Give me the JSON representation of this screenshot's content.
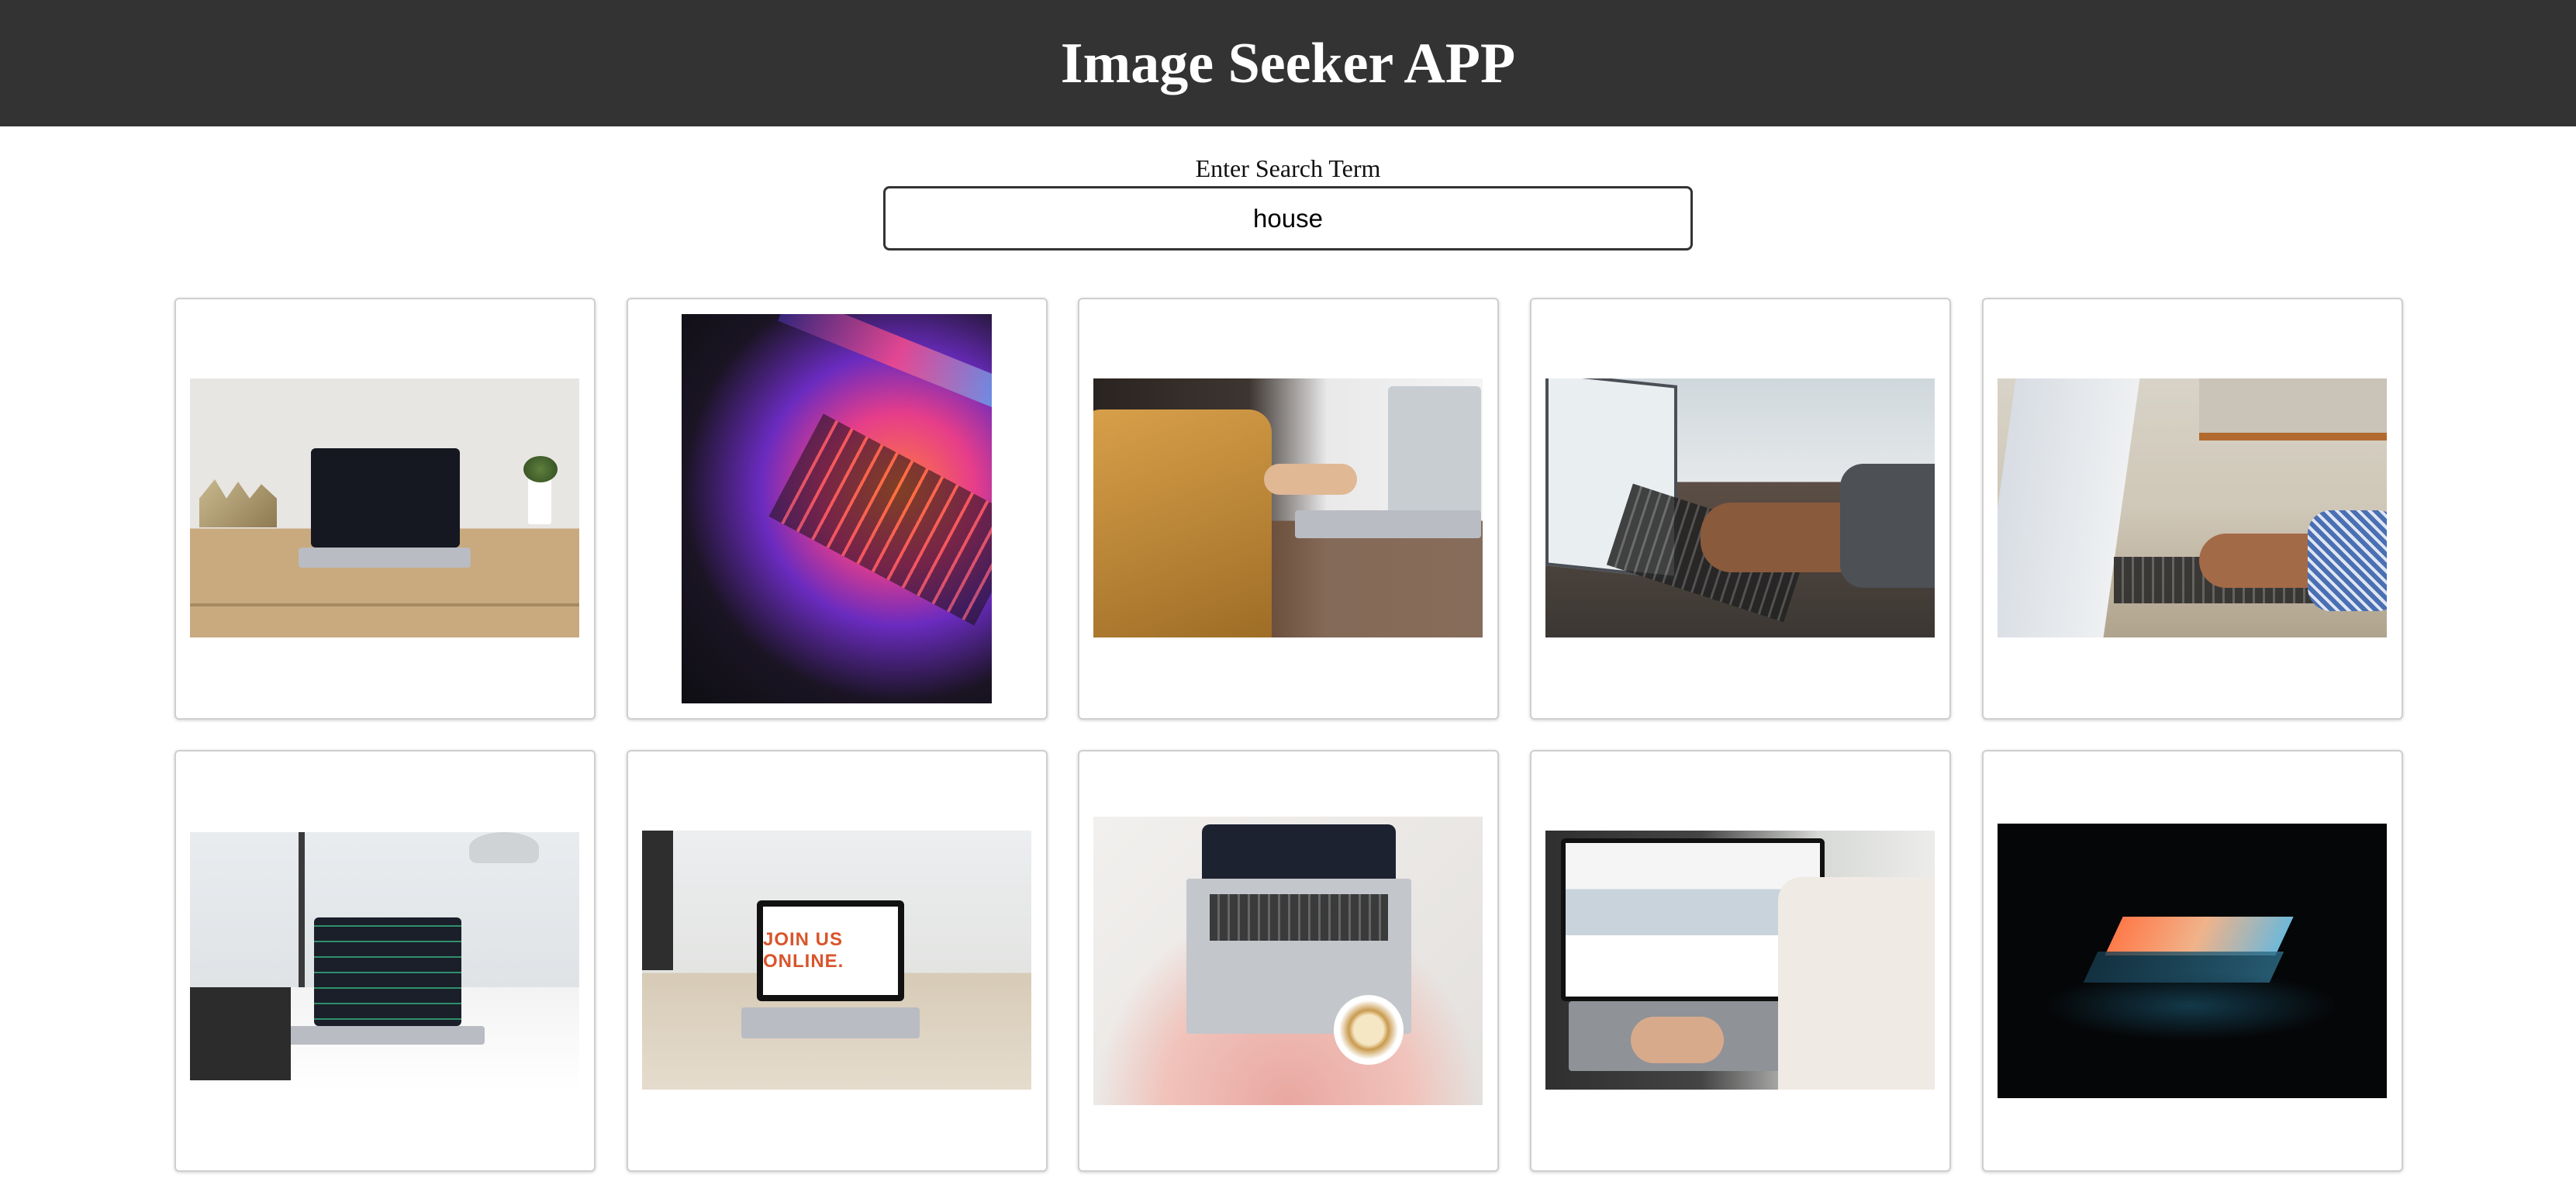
{
  "header": {
    "title": "Image Seeker APP"
  },
  "search": {
    "label": "Enter Search Term",
    "value": "house"
  },
  "results": [
    {
      "alt": "laptop on wooden desk with plant"
    },
    {
      "alt": "laptop keyboard with colorful light"
    },
    {
      "alt": "person in yellow sweater typing on laptop"
    },
    {
      "alt": "hands typing on laptop keyboard"
    },
    {
      "alt": "hands typing on laptop with window background"
    },
    {
      "alt": "laptop with code on white desk"
    },
    {
      "alt": "laptop showing text on screen on table"
    },
    {
      "alt": "laptop on lap with coffee cup"
    },
    {
      "alt": "person browsing website on laptop"
    },
    {
      "alt": "laptop glowing in dark"
    }
  ],
  "colors": {
    "header_bg": "#333333",
    "header_text": "#ffffff",
    "page_bg": "#ffffff"
  }
}
